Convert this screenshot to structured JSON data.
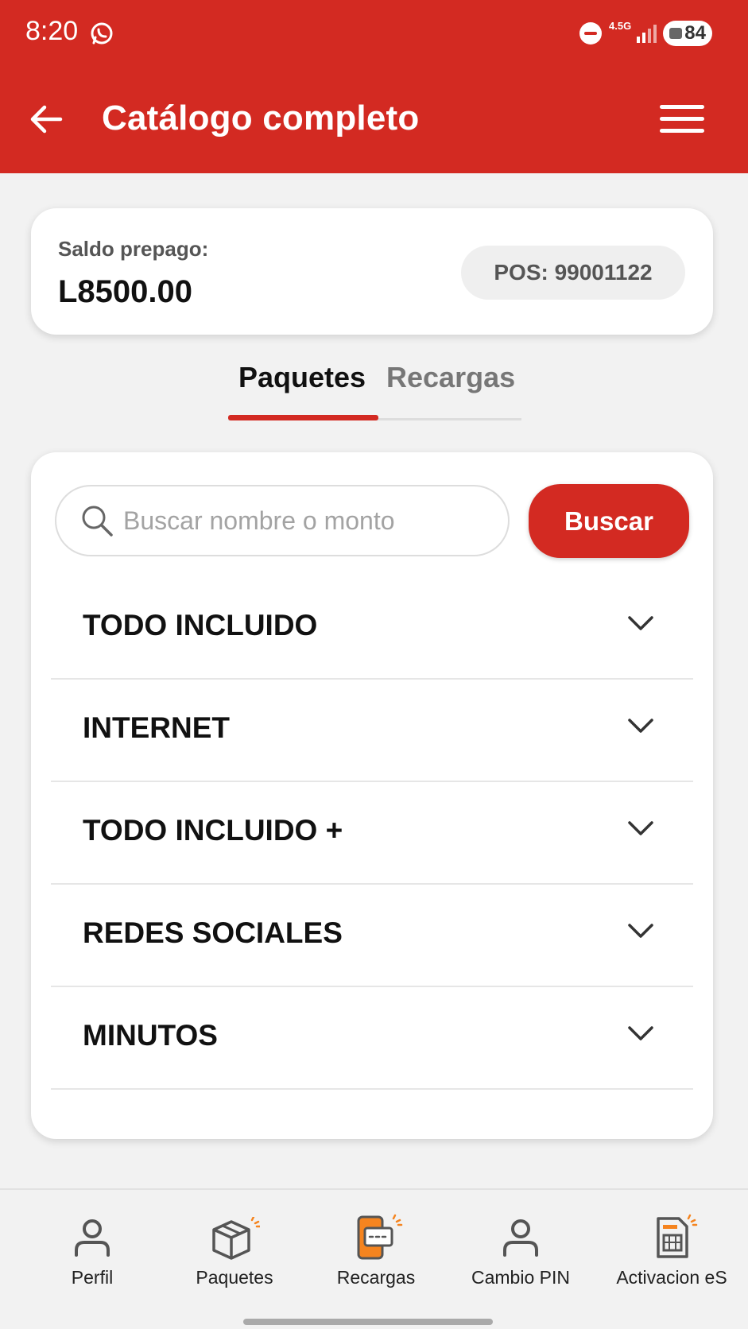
{
  "status_bar": {
    "time": "8:20",
    "network": "4.5G",
    "battery": "84",
    "icons": [
      "whatsapp-icon",
      "do-not-disturb-icon",
      "signal-icon",
      "battery-icon"
    ]
  },
  "header": {
    "title": "Catálogo completo",
    "back_icon": "arrow-left-icon",
    "menu_icon": "hamburger-menu-icon"
  },
  "balance": {
    "label": "Saldo prepago:",
    "value": "L8500.00",
    "pos": "POS: 99001122"
  },
  "tabs": [
    {
      "label": "Paquetes",
      "active": true
    },
    {
      "label": "Recargas",
      "active": false
    }
  ],
  "search": {
    "placeholder": "Buscar nombre o monto",
    "value": "",
    "button_label": "Buscar"
  },
  "categories": [
    {
      "label": "TODO INCLUIDO"
    },
    {
      "label": "INTERNET"
    },
    {
      "label": "TODO INCLUIDO +"
    },
    {
      "label": "REDES SOCIALES"
    },
    {
      "label": "MINUTOS"
    }
  ],
  "bottom_nav": [
    {
      "label": "Perfil",
      "icon": "person-icon"
    },
    {
      "label": "Paquetes",
      "icon": "package-box-icon"
    },
    {
      "label": "Recargas",
      "icon": "phone-card-icon"
    },
    {
      "label": "Cambio PIN",
      "icon": "person-icon"
    },
    {
      "label": "Activacion eS",
      "icon": "sim-card-icon"
    }
  ],
  "colors": {
    "brand_red": "#d32a22",
    "accent_orange": "#f5841f",
    "background": "#f2f2f2"
  }
}
